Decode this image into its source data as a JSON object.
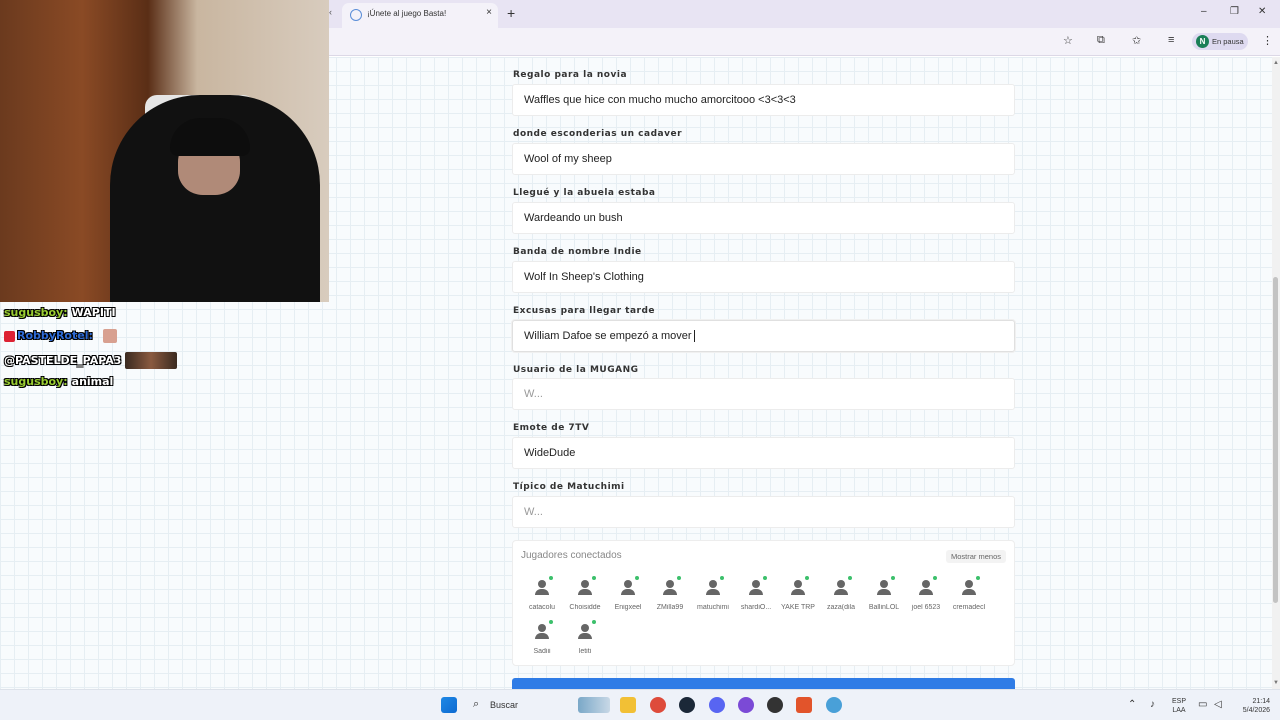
{
  "browser": {
    "tab_title": "¡Únete al juego Basta!",
    "tab_close": "×",
    "new_tab": "+",
    "tab_arrow": "‹",
    "profile_initial": "N",
    "profile_label": "En pausa",
    "window_controls": {
      "minimize": "–",
      "maximize": "❐",
      "close": "✕"
    }
  },
  "form": {
    "fields": [
      {
        "label": "Regalo para la novia",
        "value": "Waffles que hice con mucho mucho amorcitooo <3<3<3"
      },
      {
        "label": "donde esconderias un cadaver",
        "value": "Wool of my sheep"
      },
      {
        "label": "Llegué y la abuela estaba",
        "value": "Wardeando un bush"
      },
      {
        "label": "Banda de nombre Indie",
        "value": "Wolf In Sheep's Clothing"
      },
      {
        "label": "Excusas para llegar tarde",
        "value": "William Dafoe se empezó a mover"
      },
      {
        "label": "Usuario de la MUGANG",
        "placeholder": "W..."
      },
      {
        "label": "Emote de 7TV",
        "value": "WideDude"
      },
      {
        "label": "Típico de Matuchimi",
        "placeholder": "W..."
      }
    ]
  },
  "players_panel": {
    "title": "Jugadores conectados",
    "toggle_label": "Mostrar menos",
    "players": [
      "catacolu",
      "Choisidde",
      "Enigxeel",
      "ZMilla99",
      "matuchimi",
      "shardiO...",
      "YAKE TRP",
      "zaza(dila",
      "BallinLOL",
      "joel 6523",
      "cremadecl",
      "Sadiii",
      "letiti"
    ]
  },
  "chat": [
    {
      "user": "sugusboy:",
      "message": "WAPITI",
      "user_color": "#9acd32"
    },
    {
      "user": "RobbyRotel:",
      "message": "",
      "user_color": "#2e6bd6"
    },
    {
      "user": "@PASTELDE_PAPA3",
      "message": "",
      "user_color": "#ffffff"
    },
    {
      "user": "sugusboy:",
      "message": "animal",
      "user_color": "#9acd32"
    }
  ],
  "taskbar": {
    "search_label": "Buscar",
    "lang_top": "ESP",
    "lang_bottom": "LAA",
    "time": "21:14",
    "date": "5/4/2026"
  }
}
